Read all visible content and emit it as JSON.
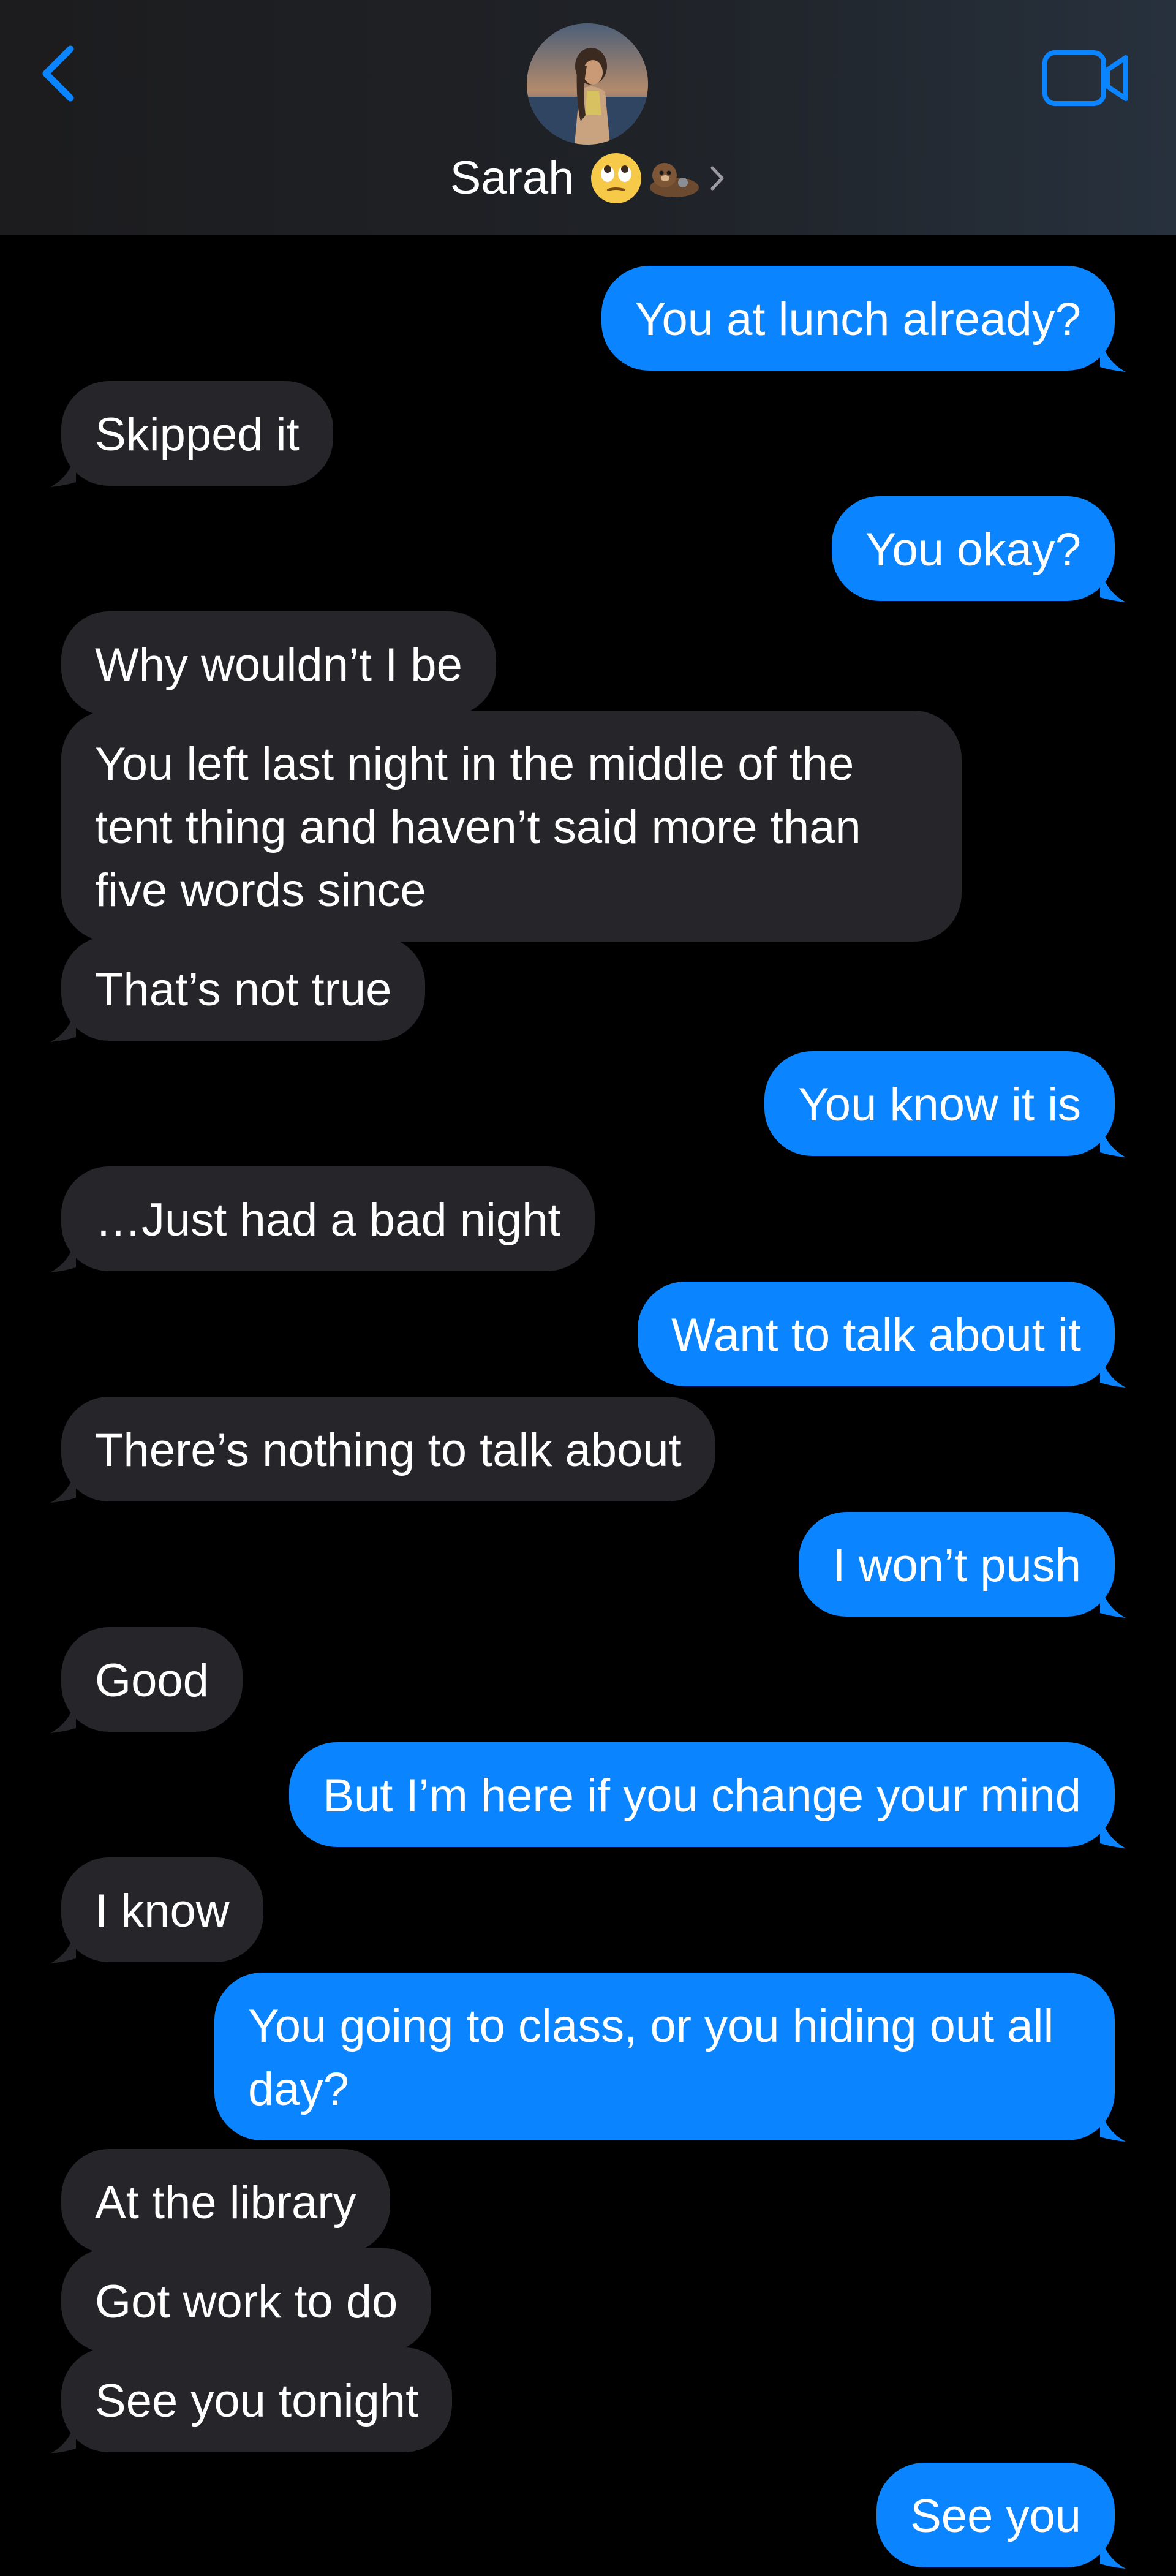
{
  "header": {
    "contact_name": "Sarah",
    "contact_emoji": "🙄",
    "back_icon": "chevron-left-icon",
    "video_icon": "video-camera-icon"
  },
  "colors": {
    "outgoing_bubble": "#0a84ff",
    "incoming_bubble": "#26252a",
    "accent": "#0a84ff",
    "background": "#000000"
  },
  "messages": [
    {
      "dir": "out",
      "text": "You at lunch already?"
    },
    {
      "dir": "in",
      "text": "Skipped it"
    },
    {
      "dir": "out",
      "text": "You okay?"
    },
    {
      "dir": "in",
      "text": "Why wouldn’t I be"
    },
    {
      "dir": "in",
      "text": "You left last night in the middle of the tent thing and haven’t said more than five words since"
    },
    {
      "dir": "in",
      "text": "That’s not true"
    },
    {
      "dir": "out",
      "text": "You know it is"
    },
    {
      "dir": "in",
      "text": "…Just had a bad night"
    },
    {
      "dir": "out",
      "text": "Want to talk about it"
    },
    {
      "dir": "in",
      "text": "There’s nothing to talk about"
    },
    {
      "dir": "out",
      "text": "I won’t push"
    },
    {
      "dir": "in",
      "text": "Good"
    },
    {
      "dir": "out",
      "text": "But I’m here if you change your mind"
    },
    {
      "dir": "in",
      "text": "I know"
    },
    {
      "dir": "out",
      "text": "You going to class, or you hiding out all day?"
    },
    {
      "dir": "in",
      "text": "At the library"
    },
    {
      "dir": "in",
      "text": "Got work to do"
    },
    {
      "dir": "in",
      "text": "See you tonight"
    },
    {
      "dir": "out",
      "text": "See you"
    }
  ]
}
